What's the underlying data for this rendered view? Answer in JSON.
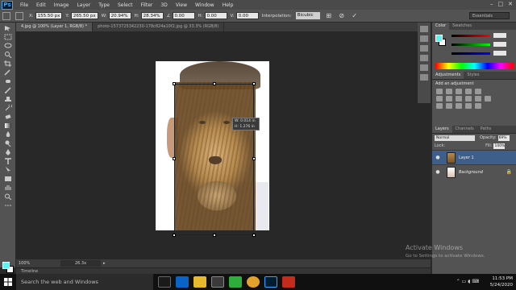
{
  "app": {
    "logo": "Ps"
  },
  "menu": [
    "File",
    "Edit",
    "Image",
    "Layer",
    "Type",
    "Select",
    "Filter",
    "3D",
    "View",
    "Window",
    "Help"
  ],
  "window_controls": [
    "–",
    "□",
    "✕"
  ],
  "options": {
    "x_label": "X:",
    "x_value": "155.50 px",
    "y_label": "Y:",
    "y_value": "265.50 px",
    "w_label": "W:",
    "w_value": "20.94%",
    "h_label": "H:",
    "h_value": "28.34%",
    "angle_label": "∠",
    "angle_value": "0.00",
    "hskew_label": "H:",
    "hskew_value": "0.00",
    "vskew_label": "V:",
    "vskew_value": "0.00",
    "interp_label": "Interpolation:",
    "interp_value": "Bicubic",
    "workspace": "Essentials"
  },
  "doc_tabs": [
    "4.jpg @ 100% (Layer 1, RGB/8) *",
    "photo-1573725342230-178c824a10f2.jpg @ 33.3% (RGB/8)"
  ],
  "transform_readout": {
    "line1": "W: 0.014 in",
    "line2": "H: 1.276 in"
  },
  "status": {
    "zoom": "100%",
    "doc": "26.3x"
  },
  "timeline": "Timeline",
  "panels": {
    "color_tabs": [
      "Color",
      "Swatches"
    ],
    "slider_values": [
      "",
      "",
      ""
    ],
    "adjust_tabs": [
      "Adjustments",
      "Styles"
    ],
    "adjust_title": "Add an adjustment",
    "layers_tabs": [
      "Layers",
      "Channels",
      "Paths"
    ],
    "blend_mode": "Normal",
    "opacity_label": "Opacity:",
    "opacity_value": "69%",
    "lock_label": "Lock:",
    "fill_label": "Fill:",
    "fill_value": "100%",
    "layers": [
      {
        "name": "Layer 1",
        "active": true
      },
      {
        "name": "Background",
        "active": false
      }
    ]
  },
  "watermark": {
    "title": "Activate Windows",
    "sub": "Go to Settings to activate Windows."
  },
  "taskbar": {
    "search": "Search the web and Windows",
    "time": "11:53 PM",
    "date": "5/24/2020"
  },
  "colors": {
    "foreground": "#5ef2f2",
    "selection": "#3e5f8a"
  }
}
